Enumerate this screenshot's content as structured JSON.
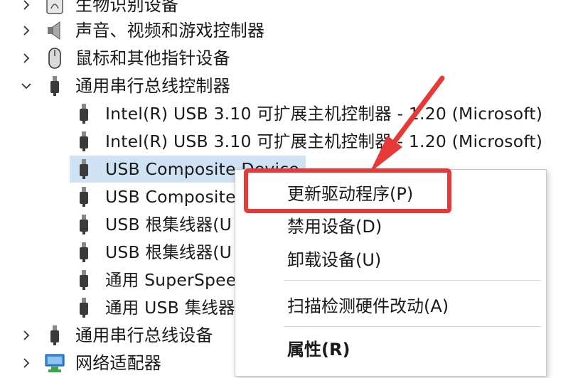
{
  "tree": {
    "items": [
      {
        "label": "生物识别设备",
        "expanded": false,
        "icon": "biometric-icon"
      },
      {
        "label": "声音、视频和游戏控制器",
        "expanded": false,
        "icon": "speaker-icon"
      },
      {
        "label": "鼠标和其他指针设备",
        "expanded": false,
        "icon": "mouse-icon"
      },
      {
        "label": "通用串行总线控制器",
        "expanded": true,
        "icon": "usb-plug-icon"
      },
      {
        "label": "通用串行总线设备",
        "expanded": false,
        "icon": "usb-plug-icon"
      },
      {
        "label": "网络适配器",
        "expanded": false,
        "icon": "network-adapter-icon"
      }
    ],
    "children": [
      {
        "label": "Intel(R) USB 3.10 可扩展主机控制器 - 1.20 (Microsoft)",
        "icon": "usb-plug-icon"
      },
      {
        "label": "Intel(R) USB 3.10 可扩展主机控制器 - 1.20 (Microsoft)",
        "icon": "usb-plug-icon"
      },
      {
        "label": "USB Composite Device",
        "icon": "usb-plug-icon",
        "selected": true
      },
      {
        "label": "USB Composite",
        "icon": "usb-plug-icon"
      },
      {
        "label": "USB 根集线器(U",
        "icon": "usb-plug-icon"
      },
      {
        "label": "USB 根集线器(U",
        "icon": "usb-plug-icon"
      },
      {
        "label": "通用 SuperSpee",
        "icon": "usb-plug-icon"
      },
      {
        "label": "通用 USB 集线器",
        "icon": "usb-plug-icon"
      }
    ]
  },
  "context_menu": {
    "update_driver": "更新驱动程序(P)",
    "disable_device": "禁用设备(D)",
    "uninstall_device": "卸载设备(U)",
    "scan_hardware": "扫描检测硬件改动(A)",
    "properties": "属性(R)"
  },
  "colors": {
    "highlight": "#e53a37",
    "selection": "#cfe3f5"
  }
}
